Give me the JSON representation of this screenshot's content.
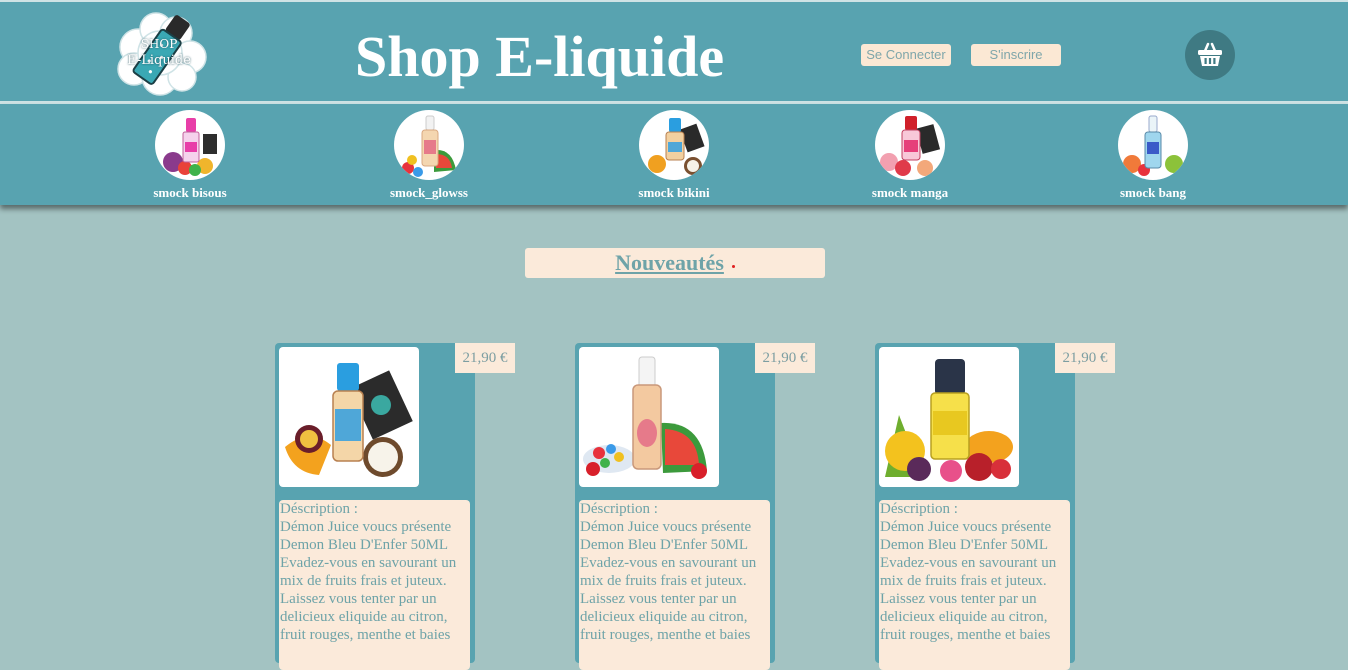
{
  "header": {
    "logo_line1": "SHOP",
    "logo_line2": "E-Liquide",
    "title": "Shop E-liquide",
    "login_label": "Se Connecter",
    "signup_label": "S'inscrire",
    "cart_icon": "basket-icon"
  },
  "categories": [
    {
      "label": "smock bisous",
      "icon": "bottle-pink"
    },
    {
      "label": "smock_glowss",
      "icon": "bottle-glow"
    },
    {
      "label": "smock bikini",
      "icon": "bottle-blue"
    },
    {
      "label": "smock manga",
      "icon": "bottle-red"
    },
    {
      "label": "smock bang",
      "icon": "bottle-bang"
    }
  ],
  "section": {
    "title": "Nouveautés"
  },
  "products": [
    {
      "price": "21,90 €",
      "desc_label": "Déscription :",
      "desc_text": "Démon Juice voucs présente Demon Bleu D'Enfer 50ML Evadez-vous en savourant un mix de fruits frais et juteux. Laissez vous tenter par un delicieux eliquide au citron, fruit rouges, menthe et baies"
    },
    {
      "price": "21,90 €",
      "desc_label": "Déscription :",
      "desc_text": "Démon Juice voucs présente Demon Bleu D'Enfer 50ML Evadez-vous en savourant un mix de fruits frais et juteux. Laissez vous tenter par un delicieux eliquide au citron, fruit rouges, menthe et baies"
    },
    {
      "price": "21,90 €",
      "desc_label": "Déscription :",
      "desc_text": "Démon Juice voucs présente Demon Bleu D'Enfer 50ML Evadez-vous en savourant un mix de fruits frais et juteux. Laissez vous tenter par un delicieux eliquide au citron, fruit rouges, menthe et baies"
    }
  ],
  "colors": {
    "header_bg": "#58a3b0",
    "page_bg": "#a3c3c2",
    "cream": "#fbeada",
    "text_teal": "#6ea3a8"
  }
}
